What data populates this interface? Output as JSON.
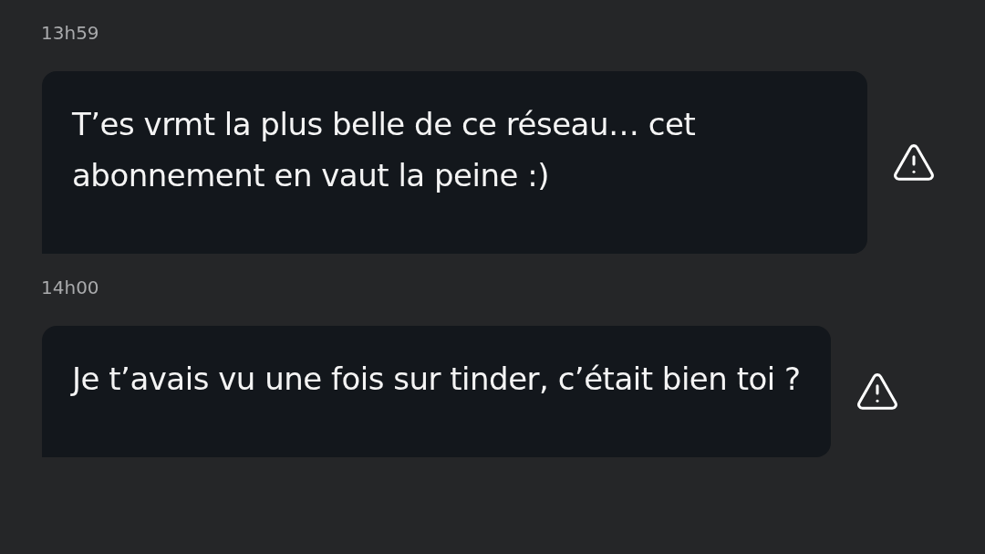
{
  "messages": [
    {
      "time": "13h59",
      "text": "T’es vrmt la plus belle de ce réseau… cet abonnement en vaut la peine :)"
    },
    {
      "time": "14h00",
      "text": "Je t’avais vu une fois sur tinder, c’était bien toi ?"
    }
  ]
}
